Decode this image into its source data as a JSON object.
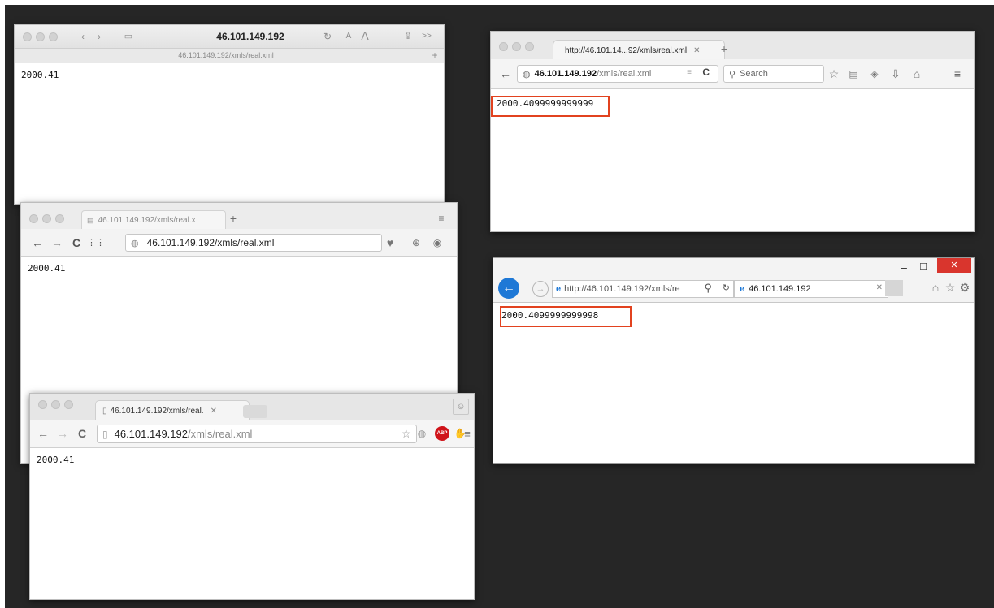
{
  "safari": {
    "title": "46.101.149.192",
    "url": "46.101.149.192/xmls/real.xml",
    "font_small": "A",
    "font_large": "A",
    "more": ">>",
    "content": "2000.41"
  },
  "firefox": {
    "tab_title": "http://46.101.14...92/xmls/real.xml",
    "url_host": "46.101.149.192",
    "url_path": "/xmls/real.xml",
    "search_placeholder": "Search",
    "content": "2000.4099999999999"
  },
  "opera": {
    "tab_title": "46.101.149.192/xmls/real.x",
    "url": "46.101.149.192/xmls/real.xml",
    "content": "2000.41"
  },
  "ie": {
    "url": "http://46.101.149.192/xmls/re",
    "tab_title": "46.101.149.192",
    "content": "2000.4099999999998"
  },
  "chrome": {
    "tab_title": "46.101.149.192/xmls/real.",
    "url_host": "46.101.149.192",
    "url_path": "/xmls/real.xml",
    "abp": "ABP",
    "content": "2000.41"
  },
  "colors": {
    "desktop": "#262626",
    "highlight": "#e2421f",
    "ie_back": "#1e78d6",
    "ie_close": "#d9352d",
    "abp_red": "#d0141a"
  }
}
